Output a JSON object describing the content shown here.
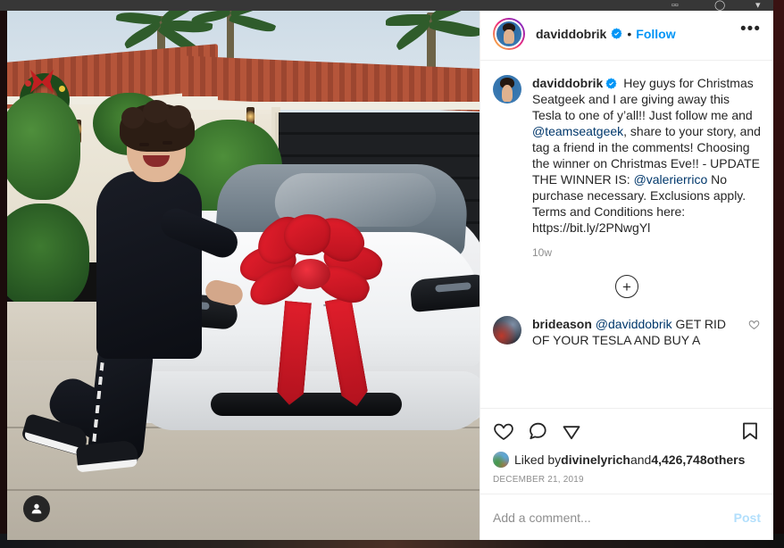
{
  "top_chrome": {
    "glyph_a": "▫▫",
    "glyph_b": "◯",
    "glyph_c": "▾"
  },
  "media": {
    "alt": "Man in black sweater leaning on a white Tesla with a large red bow in a driveway",
    "account_badge_icon": "person-icon"
  },
  "header": {
    "username": "daviddobrik",
    "verified_icon": "verified-badge-icon",
    "separator": "•",
    "follow_label": "Follow",
    "more_options_label": "•••"
  },
  "caption": {
    "username": "daviddobrik",
    "verified_icon": "verified-badge-icon",
    "text_1": " Hey guys for Christmas Seatgeek and I are giving away this Tesla to one of y’all!! Just follow me and ",
    "mention_1": "@teamseatgeek",
    "text_2": ", share to your story, and tag a friend in the comments! Choosing the winner on Christmas Eve!! - UPDATE THE WINNER IS: ",
    "mention_2": "@valerierrico",
    "text_3": " No purchase necessary. Exclusions apply. Terms and Conditions here: https://bit.ly/2PNwgYl",
    "timestamp": "10w"
  },
  "load_more": {
    "icon": "plus-icon",
    "label": "+"
  },
  "comments": [
    {
      "username": "brideason",
      "mention": "@daviddobrik",
      "text": " GET RID OF YOUR TESLA AND BUY A",
      "like_icon": "heart-outline-icon"
    }
  ],
  "actions": {
    "like_icon": "heart-icon",
    "comment_icon": "comment-icon",
    "share_icon": "share-paper-plane-icon",
    "save_icon": "bookmark-icon"
  },
  "likes": {
    "prefix": "Liked by ",
    "liker": "divinelyrich",
    "middle": " and ",
    "count": "4,426,748",
    "suffix": " others"
  },
  "post_date": "DECEMBER 21, 2019",
  "add_comment": {
    "placeholder": "Add a comment...",
    "value": "",
    "post_label": "Post"
  },
  "colors": {
    "instagram_blue": "#0095f6",
    "link_navy": "#00376b",
    "text_primary": "#262626",
    "text_secondary": "#8e8e8e",
    "post_disabled": "#b2dffc"
  }
}
